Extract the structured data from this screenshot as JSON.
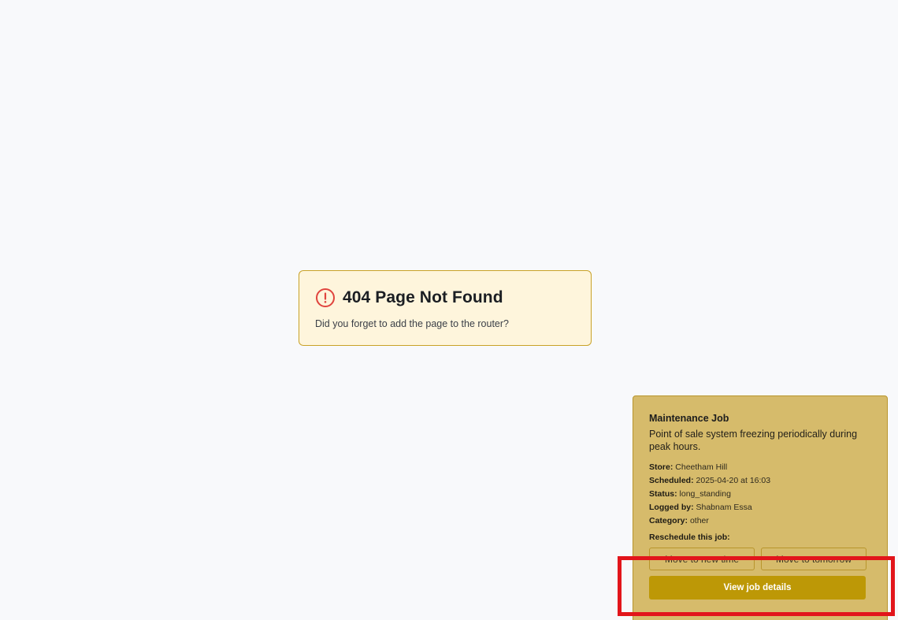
{
  "not_found": {
    "icon": "alert-circle-icon",
    "title": "404 Page Not Found",
    "message": "Did you forget to add the page to the router?",
    "icon_color": "#e0443e"
  },
  "job": {
    "heading": "Maintenance Job",
    "description": "Point of sale system freezing periodically during peak hours.",
    "fields": [
      {
        "label": "Store:",
        "value": "Cheetham Hill"
      },
      {
        "label": "Scheduled:",
        "value": "2025-04-20 at 16:03"
      },
      {
        "label": "Status:",
        "value": "long_standing"
      },
      {
        "label": "Logged by:",
        "value": "Shabnam Essa"
      },
      {
        "label": "Category:",
        "value": "other"
      }
    ],
    "reschedule_label": "Reschedule this job:",
    "move_new_time_label": "Move to new time",
    "move_tomorrow_label": "Move to tomorrow",
    "view_details_label": "View job details"
  },
  "colors": {
    "page_bg": "#f8f9fb",
    "card_bg": "#fef5dc",
    "card_border": "#c9a227",
    "job_bg": "#d6bb6b",
    "primary_button": "#bd9806",
    "highlight": "#e2151b"
  }
}
